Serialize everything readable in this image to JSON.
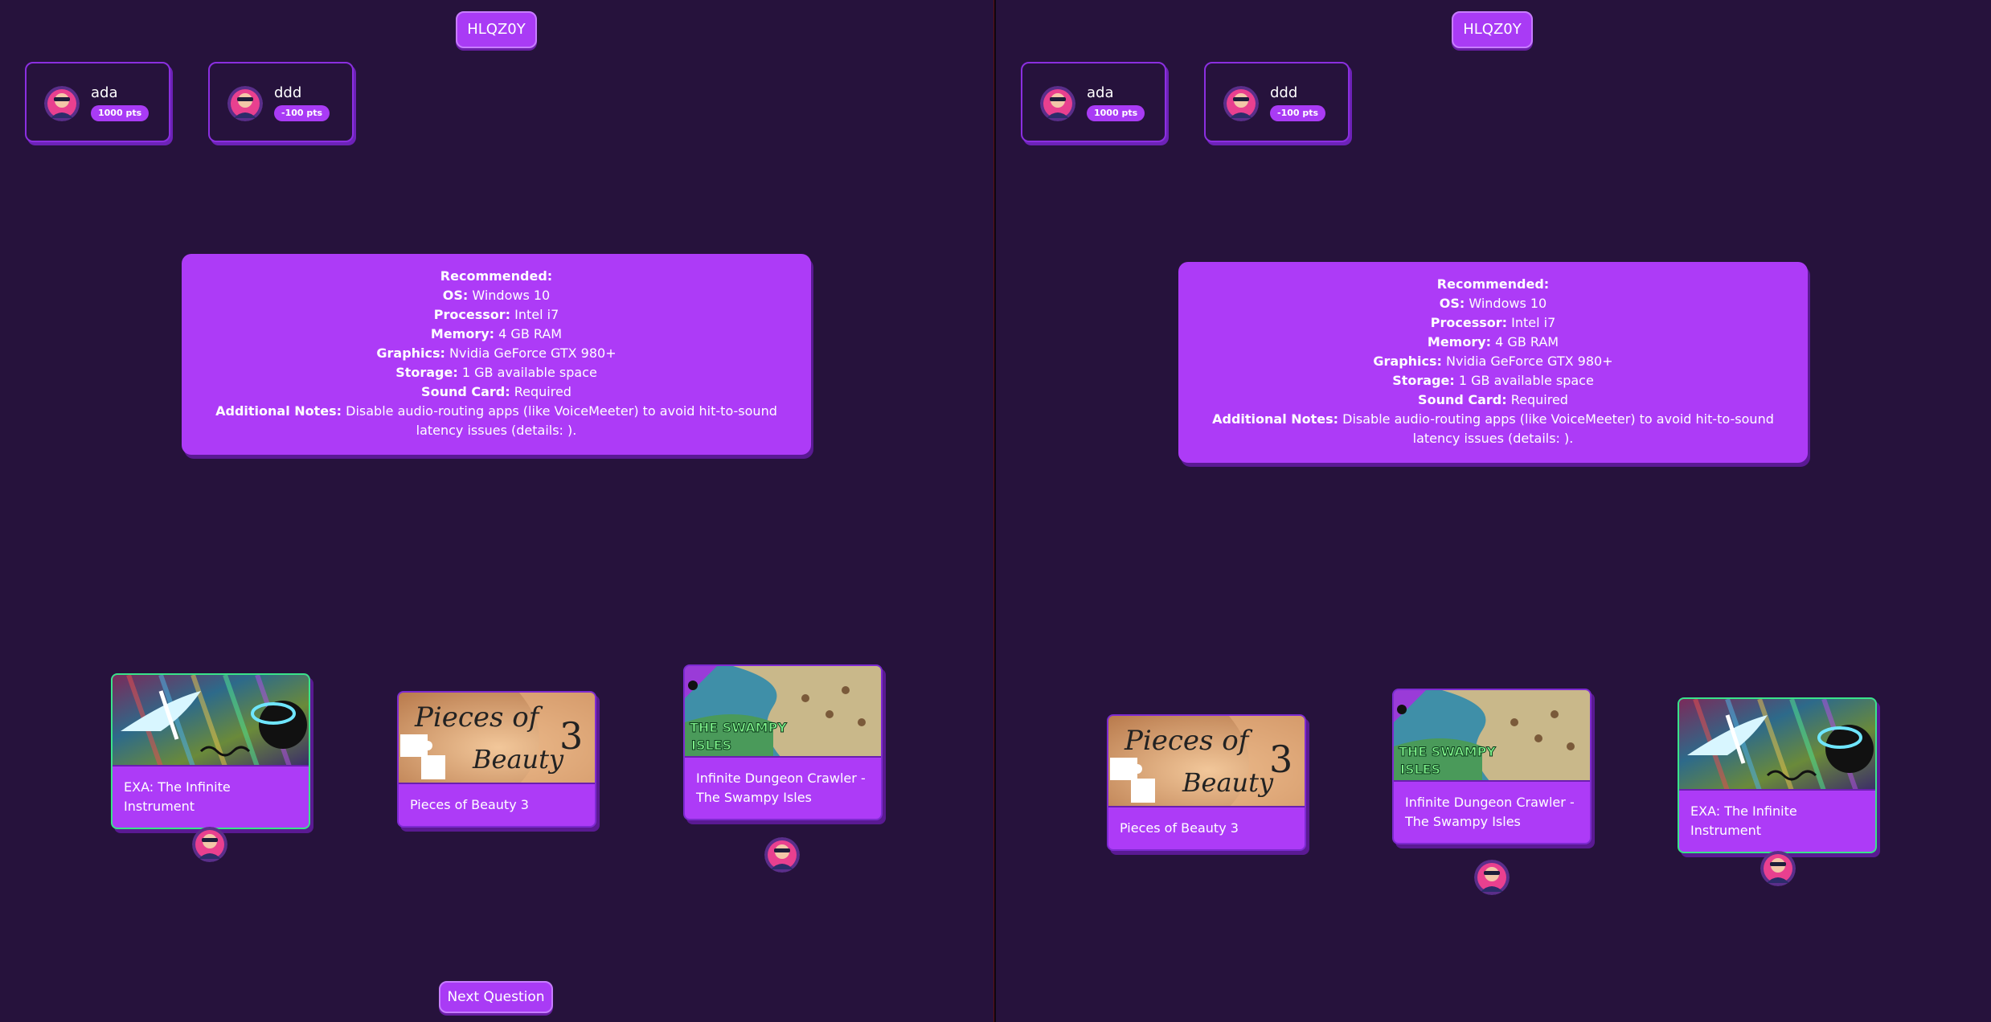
{
  "room": {
    "code": "HLQZ0Y"
  },
  "players": [
    {
      "name": "ada",
      "points": "1000 pts"
    },
    {
      "name": "ddd",
      "points": "-100 pts"
    }
  ],
  "requirements": [
    {
      "key": "Recommended:",
      "value": ""
    },
    {
      "key": "OS:",
      "value": " Windows 10"
    },
    {
      "key": "Processor:",
      "value": " Intel i7"
    },
    {
      "key": "Memory:",
      "value": " 4 GB RAM"
    },
    {
      "key": "Graphics:",
      "value": " Nvidia GeForce GTX 980+"
    },
    {
      "key": "Storage:",
      "value": " 1 GB available space"
    },
    {
      "key": "Sound Card:",
      "value": " Required"
    },
    {
      "key": "Additional Notes:",
      "value": " Disable audio-routing apps (like VoiceMeeter) to avoid hit-to-sound latency issues (details: )."
    }
  ],
  "games": {
    "exa": "EXA: The Infinite Instrument",
    "pob": "Pieces of Beauty 3",
    "idc": "Infinite Dungeon Crawler - The Swampy Isles"
  },
  "art_text": {
    "pob_title": "Pieces of",
    "pob_title2": "Beauty",
    "pob_num": "3",
    "swampy": "THE SWAMPY",
    "isles": "ISLES"
  },
  "controls": {
    "next": "Next Question"
  },
  "colors": {
    "bg": "#26123c",
    "accent": "#ad3bf7",
    "correct": "#39e38a"
  }
}
